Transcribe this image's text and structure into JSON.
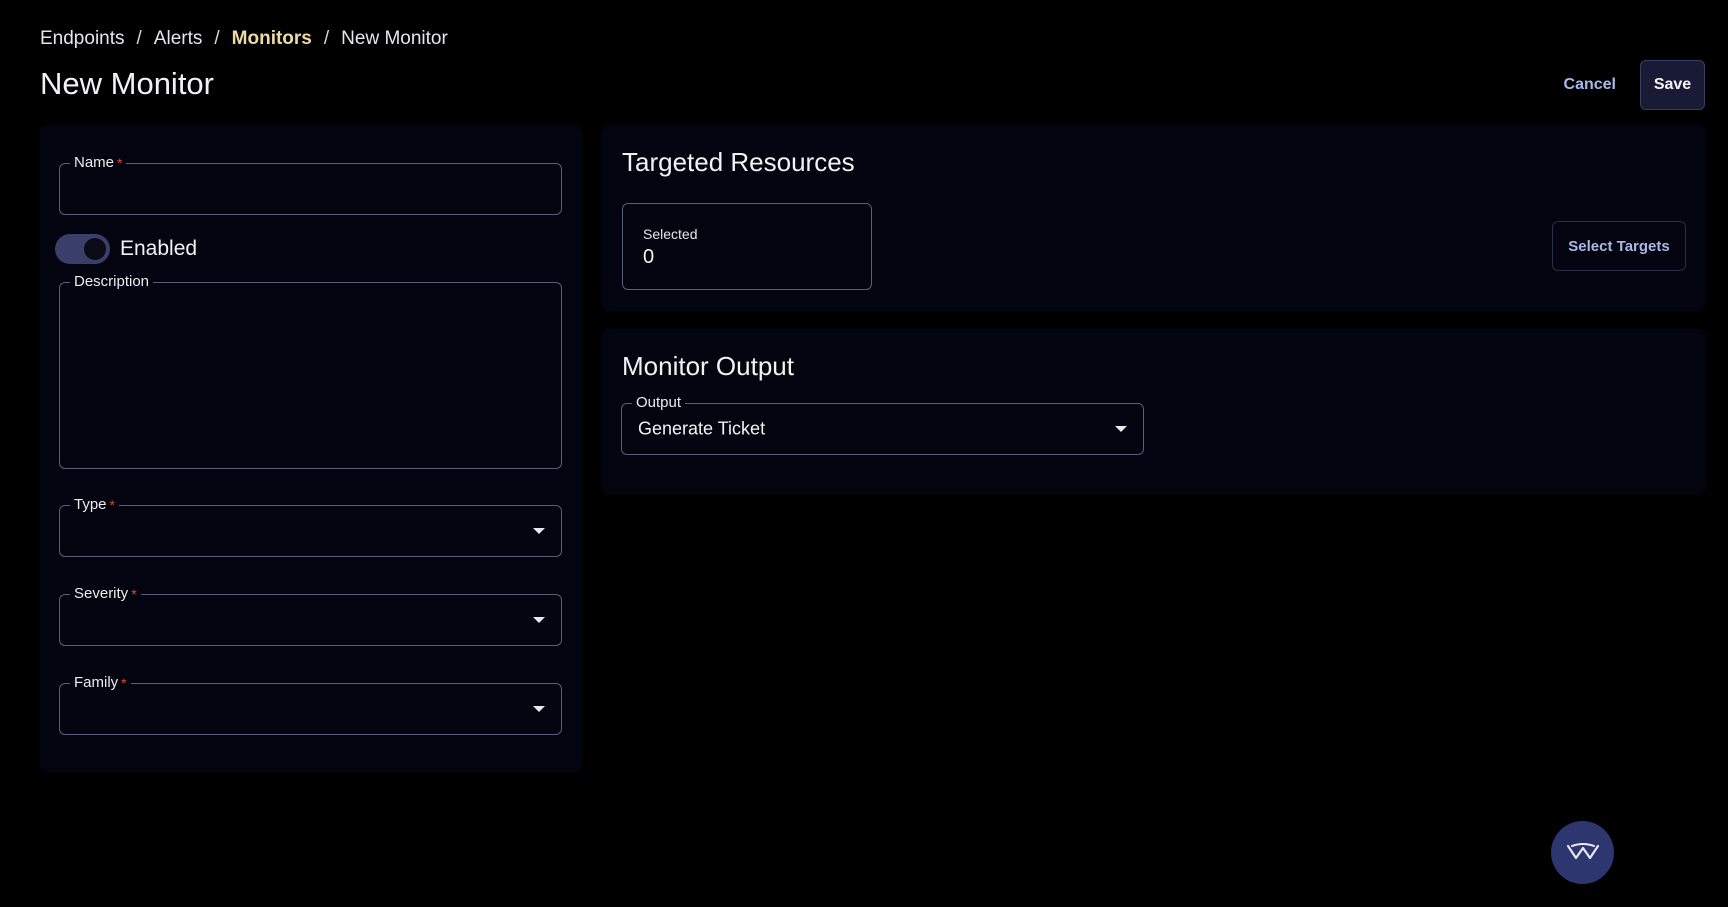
{
  "breadcrumb": {
    "items": [
      "Endpoints",
      "Alerts",
      "Monitors",
      "New Monitor"
    ],
    "separator": "/"
  },
  "page_title": "New Monitor",
  "actions": {
    "cancel": "Cancel",
    "save": "Save"
  },
  "form": {
    "name": {
      "label": "Name",
      "required_mark": "*",
      "value": ""
    },
    "enabled": {
      "label": "Enabled",
      "on": true
    },
    "description": {
      "label": "Description",
      "value": ""
    },
    "type": {
      "label": "Type",
      "required_mark": "*",
      "value": ""
    },
    "severity": {
      "label": "Severity",
      "required_mark": "*",
      "value": ""
    },
    "family": {
      "label": "Family",
      "required_mark": "*",
      "value": ""
    }
  },
  "targeted_resources": {
    "title": "Targeted Resources",
    "selected_label": "Selected",
    "selected_count": "0",
    "select_button": "Select Targets"
  },
  "monitor_output": {
    "title": "Monitor Output",
    "output_label": "Output",
    "output_value": "Generate Ticket"
  },
  "fab": {
    "icon": "brand-logo-icon"
  },
  "colors": {
    "background": "#000000",
    "panel": "#03040f",
    "accent_text": "#a9b8e6",
    "breadcrumb_active": "#ecd9a6",
    "required": "#e0463c",
    "toggle_track": "#3a3f6a",
    "fab": "#2e3670"
  }
}
